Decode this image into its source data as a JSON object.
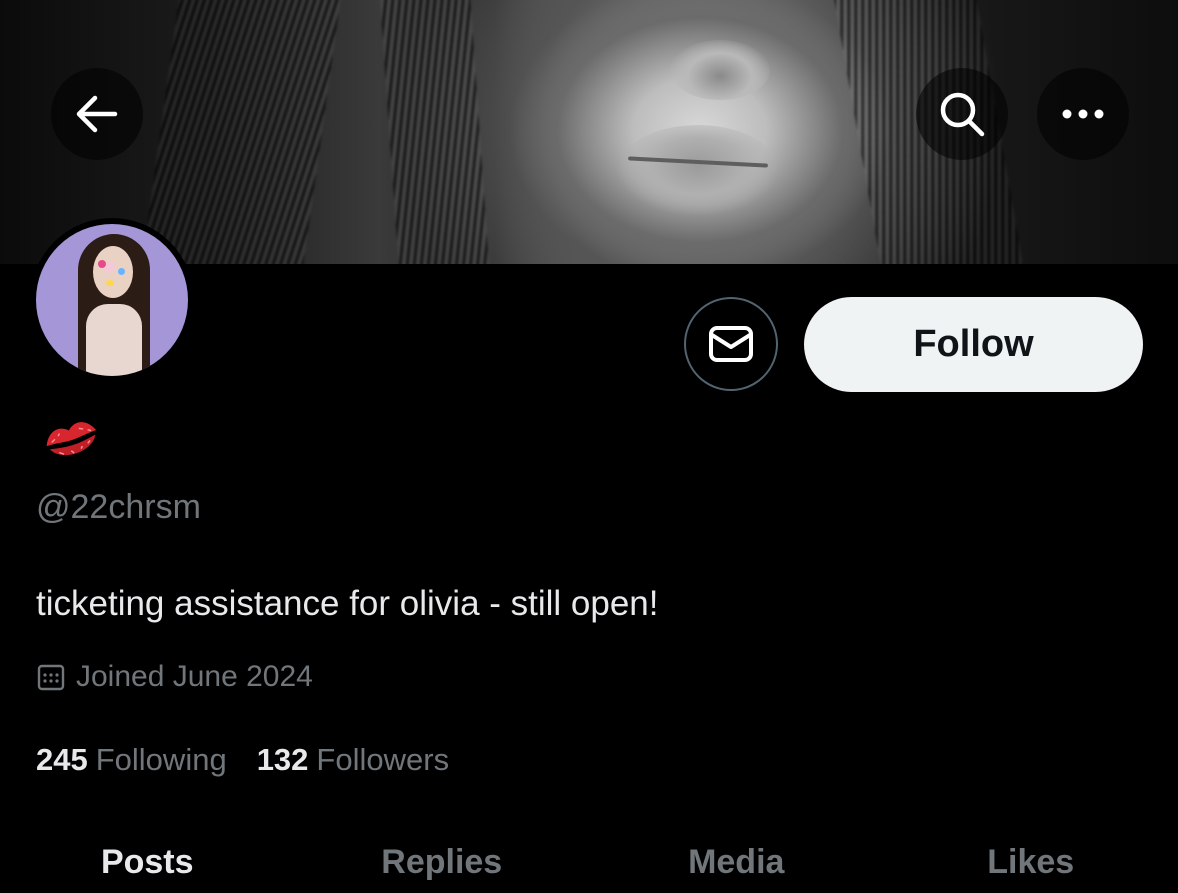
{
  "header": {
    "back_icon": "arrow-left-icon",
    "search_icon": "search-icon",
    "more_icon": "more-horizontal-icon"
  },
  "profile": {
    "display_name_emoji": "kiss-mark-emoji",
    "handle": "@22chrsm",
    "bio": "ticketing assistance for olivia - still open!",
    "joined": "Joined June 2024",
    "following_count": "245",
    "following_label": "Following",
    "followers_count": "132",
    "followers_label": "Followers"
  },
  "actions": {
    "message_icon": "envelope-icon",
    "follow_label": "Follow"
  },
  "tabs": [
    {
      "label": "Posts",
      "active": true
    },
    {
      "label": "Replies",
      "active": false
    },
    {
      "label": "Media",
      "active": false
    },
    {
      "label": "Likes",
      "active": false
    }
  ],
  "colors": {
    "background": "#000000",
    "primary_text": "#e7e9ea",
    "secondary_text": "#71767b",
    "follow_button_bg": "#eff3f4"
  }
}
